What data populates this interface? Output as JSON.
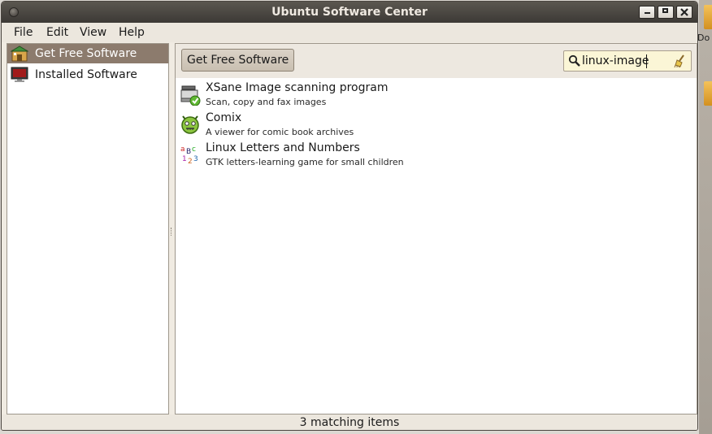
{
  "window": {
    "title": "Ubuntu Software Center"
  },
  "menu": {
    "file": "File",
    "edit": "Edit",
    "view": "View",
    "help": "Help"
  },
  "sidebar": {
    "items": [
      {
        "label": "Get Free Software",
        "icon": "get-free-software-icon",
        "selected": true
      },
      {
        "label": "Installed Software",
        "icon": "installed-software-icon",
        "selected": false
      }
    ]
  },
  "toolbar": {
    "breadcrumb": "Get Free Software"
  },
  "search": {
    "value": "linux-image"
  },
  "results": [
    {
      "name": "XSane Image scanning program",
      "description": "Scan, copy and fax images",
      "installed": true
    },
    {
      "name": "Comix",
      "description": "A viewer for comic book archives",
      "installed": false
    },
    {
      "name": "Linux Letters and Numbers",
      "description": "GTK letters-learning game for small children",
      "installed": false
    }
  ],
  "status": {
    "text": "3 matching items"
  },
  "desktop": {
    "partial_label": "Do"
  },
  "colors": {
    "selection": "#8c7b6d",
    "titlebar": "#4a4642",
    "search_bg": "#fbf6d6"
  }
}
